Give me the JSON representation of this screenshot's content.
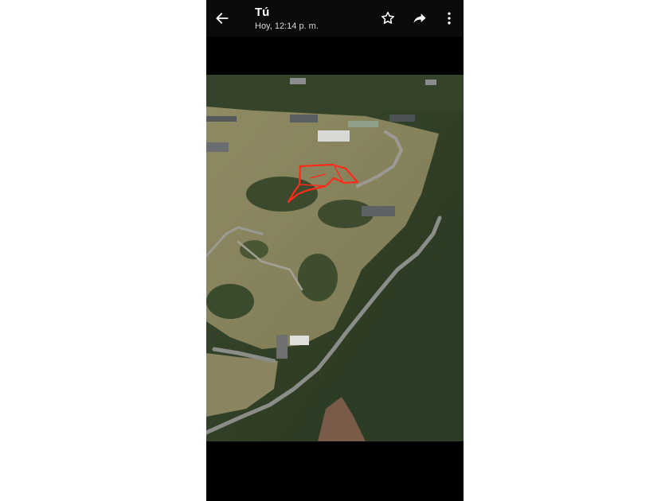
{
  "header": {
    "title": "Tú",
    "timestamp": "Hoy, 12:14 p. m.",
    "back_icon": "arrow-left-icon",
    "star_icon": "star-outline-icon",
    "share_icon": "share-forward-icon",
    "menu_icon": "more-vertical-icon"
  },
  "photo": {
    "subject": "aerial-hillside-with-red-lot-outline"
  },
  "colors": {
    "background": "#ffffff",
    "phone_bg": "#000000",
    "toolbar_bg": "#0b0b0b",
    "text_primary": "#ffffff",
    "text_secondary": "#d8d8d8",
    "lot_outline": "#ff2a1a"
  }
}
